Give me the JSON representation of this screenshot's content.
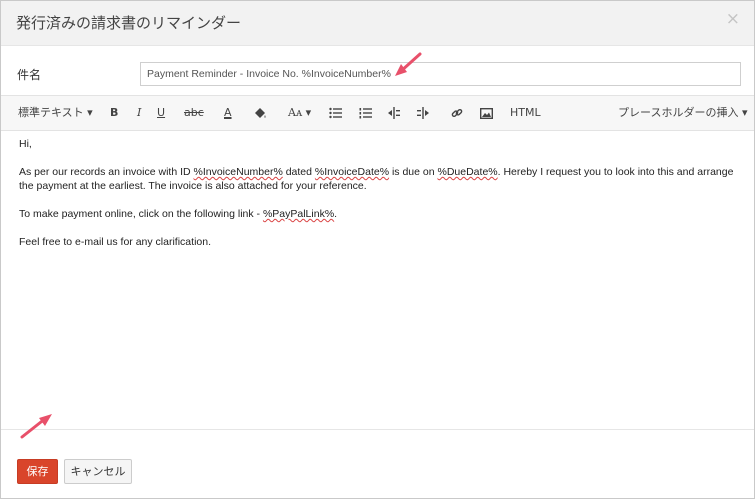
{
  "dialog": {
    "title": "発行済みの請求書のリマインダー",
    "close_glyph": "×"
  },
  "subject": {
    "label": "件名",
    "value": "Payment Reminder - Invoice No. %InvoiceNumber%"
  },
  "toolbar": {
    "format_label": "標準テキスト ▾",
    "bold_label": "B",
    "italic_label": "I",
    "underline_label": "U",
    "strike_label": "abc",
    "font_color_label": "A",
    "font_size_label": "Aᴀ ▾",
    "html_label": "HTML",
    "placeholder_menu_label": "プレースホルダーの挿入 ▾"
  },
  "body": {
    "greeting": "Hi,",
    "p1_a": "As per our records an invoice with ID ",
    "p1_ph1": "%InvoiceNumber%",
    "p1_b": " dated ",
    "p1_ph2": "%InvoiceDate%",
    "p1_c": " is due on ",
    "p1_ph3": "%DueDate%",
    "p1_d": ". Hereby I request you to look into this and arrange the payment at the earliest. The invoice is also attached for your reference.",
    "p2_a": "To make payment online, click on the following link - ",
    "p2_ph": "%PayPalLink%",
    "p2_b": ".",
    "p3": "Feel free to e-mail us for any clarification."
  },
  "footer": {
    "save_label": "保存",
    "cancel_label": "キャンセル"
  },
  "colors": {
    "save_button": "#d9452b",
    "annotation_arrow": "#e8506a",
    "spellcheck": "#d94141"
  }
}
